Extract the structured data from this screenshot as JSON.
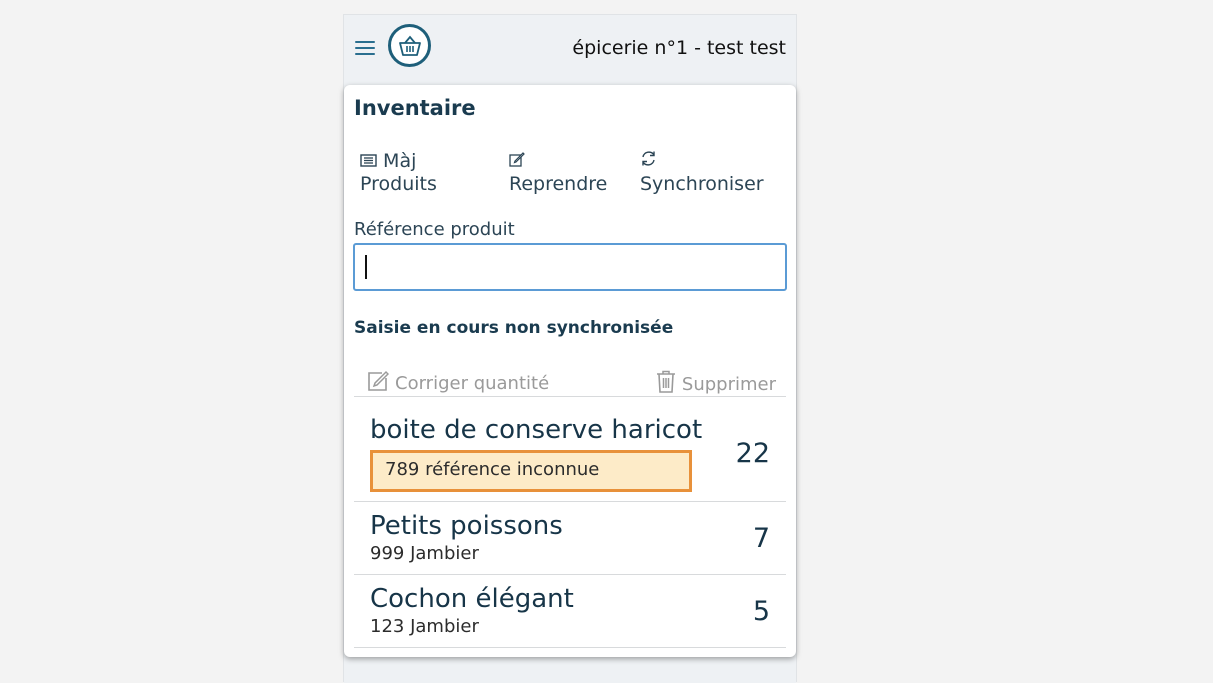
{
  "header": {
    "shop_title": "épicerie n°1 - test test"
  },
  "page": {
    "title": "Inventaire"
  },
  "actions": [
    {
      "label_line1": "Màj",
      "label_line2": "Produits",
      "icon": "list-icon"
    },
    {
      "label_line1": "",
      "label_line2": "Reprendre",
      "icon": "edit-icon"
    },
    {
      "label_line1": "",
      "label_line2": "Synchroniser",
      "icon": "sync-icon"
    }
  ],
  "reference_field": {
    "label": "Référence produit",
    "value": ""
  },
  "pending": {
    "title": "Saisie en cours non synchronisée",
    "fix_label": "Corriger quantité",
    "delete_label": "Supprimer"
  },
  "items": [
    {
      "name": "boite de conserve haricot",
      "sub": "789 référence inconnue",
      "qty": "22",
      "warning": true
    },
    {
      "name": "Petits poissons",
      "sub": "999 Jambier",
      "qty": "7",
      "warning": false
    },
    {
      "name": "Cochon élégant",
      "sub": "123 Jambier",
      "qty": "5",
      "warning": false
    }
  ],
  "colors": {
    "accent": "#1e5f7a",
    "focus_border": "#5b9bd5",
    "warning_border": "#e8913a",
    "warning_bg": "#fdebc8"
  }
}
